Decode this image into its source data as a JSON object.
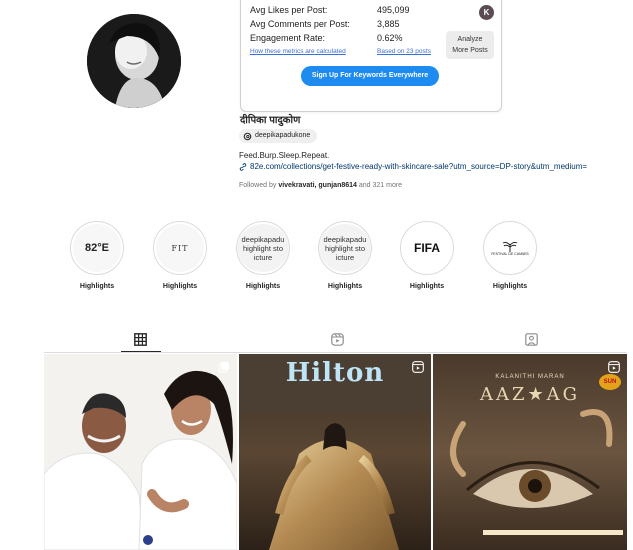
{
  "metrics": {
    "rows": [
      {
        "label": "Avg Likes per Post:",
        "value": "495,099"
      },
      {
        "label": "Avg Comments per Post:",
        "value": "3,885"
      },
      {
        "label": "Engagement Rate:",
        "value": "0.62%"
      }
    ],
    "how_link": "How these metrics are calculated",
    "based_on": "Based on 23 posts",
    "analyze_line1": "Analyze",
    "analyze_line2": "More Posts",
    "badge_letter": "K",
    "signup_label": "Sign Up For Keywords Everywhere"
  },
  "profile": {
    "username": "दीपिका पादुकोण",
    "threads_handle": "deepikapadukone",
    "bio": "Feed.Burp.Sleep.Repeat.",
    "url": "82e.com/collections/get-festive-ready-with-skincare-sale?utm_source=DP-story&utm_medium=",
    "followed_prefix": "Followed by",
    "followed_names": "vivekravati, gunjan8614",
    "followed_suffix": "and 321 more"
  },
  "highlights": [
    {
      "label": "Highlights",
      "cover_text": "82°E"
    },
    {
      "label": "Highlights",
      "cover_text": "FIT"
    },
    {
      "label": "Highlights",
      "cover_text": "deepikapadu highlight sto icture"
    },
    {
      "label": "Highlights",
      "cover_text": "deepikapadu highlight sto icture"
    },
    {
      "label": "Highlights",
      "cover_text": "FIFA"
    },
    {
      "label": "Highlights",
      "cover_text": "FESTIVAL DE CANNES"
    }
  ],
  "tabs": [
    {
      "name": "posts",
      "icon": "grid-icon",
      "active": true
    },
    {
      "name": "reels",
      "icon": "reels-icon",
      "active": false
    },
    {
      "name": "tagged",
      "icon": "tagged-icon",
      "active": false
    }
  ],
  "posts": [
    {
      "kind": "carousel",
      "overlay_text": ""
    },
    {
      "kind": "reel",
      "overlay_text": "Hilton"
    },
    {
      "kind": "reel",
      "overlay_text": "KALANITHI MARAN",
      "overlay_title": "AAZ★AG",
      "overlay_badge": "SUN"
    }
  ],
  "colors": {
    "accent": "#1d8bf0",
    "link": "#00376b",
    "muted": "#737373"
  }
}
